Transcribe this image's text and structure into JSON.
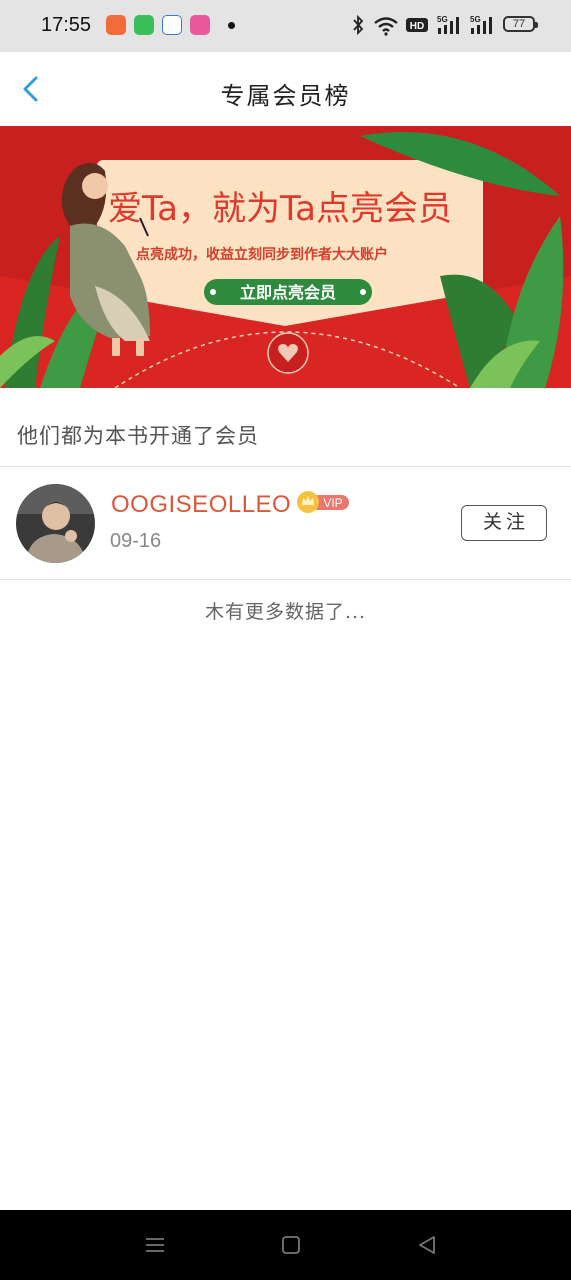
{
  "status_bar": {
    "time": "17:55",
    "network_label": "HD",
    "signal1_label": "5G",
    "signal2_label": "5G",
    "battery": "77"
  },
  "header": {
    "title": "专属会员榜"
  },
  "banner": {
    "headline": "爱Ta，就为Ta点亮会员",
    "subline": "点亮成功，收益立刻同步到作者大大账户",
    "cta": "立即点亮会员"
  },
  "section": {
    "title": "他们都为本书开通了会员"
  },
  "members": [
    {
      "username": "OOGISEOLLEO",
      "badge": "VIP",
      "date": "09-16",
      "follow_label": "关注"
    }
  ],
  "footer": {
    "no_more": "木有更多数据了..."
  },
  "colors": {
    "accent_blue": "#2f9fe0",
    "username": "#d9583a",
    "banner_red": "#c8201e",
    "cta_green": "#2e8b3e"
  }
}
